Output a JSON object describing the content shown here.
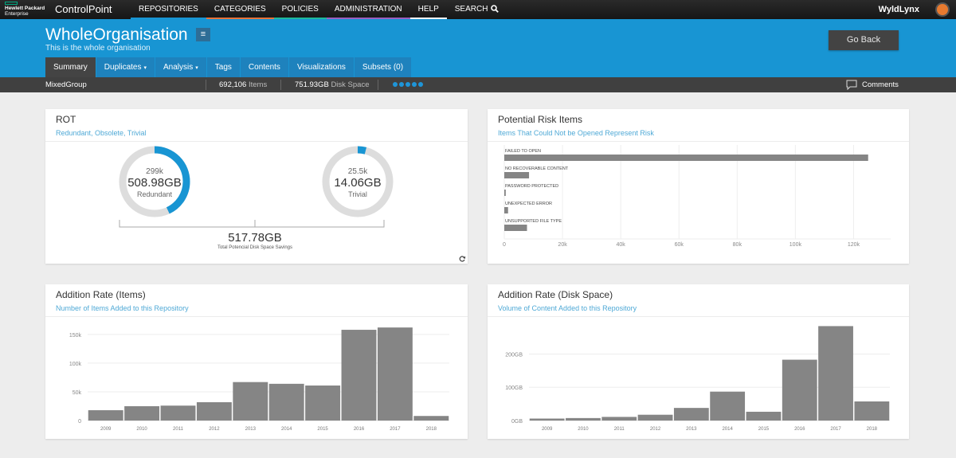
{
  "topnav": {
    "logo_line1": "Hewlett Packard",
    "logo_line2": "Enterprise",
    "brand": "ControlPoint",
    "items": [
      {
        "label": "REPOSITORIES",
        "color": "#1895d3"
      },
      {
        "label": "CATEGORIES",
        "color": "#e8733a"
      },
      {
        "label": "POLICIES",
        "color": "#1eb99a"
      },
      {
        "label": "ADMINISTRATION",
        "color": "#9b5fc0"
      },
      {
        "label": "HELP",
        "color": "#ffffff"
      }
    ],
    "search_label": "SEARCH",
    "search_icon": "search-icon",
    "username": "WyldLynx"
  },
  "header": {
    "title": "WholeOrganisation",
    "subtitle": "This is the whole organisation",
    "menu_icon": "≡",
    "go_back": "Go Back",
    "tabs": [
      {
        "label": "Summary",
        "active": true,
        "dropdown": false
      },
      {
        "label": "Duplicates",
        "active": false,
        "dropdown": true
      },
      {
        "label": "Analysis",
        "active": false,
        "dropdown": true
      },
      {
        "label": "Tags",
        "active": false,
        "dropdown": false
      },
      {
        "label": "Contents",
        "active": false,
        "dropdown": false
      },
      {
        "label": "Visualizations",
        "active": false,
        "dropdown": false
      },
      {
        "label": "Subsets (0)",
        "active": false,
        "dropdown": false
      }
    ],
    "caret": "▾"
  },
  "stats": {
    "group": "MixedGroup",
    "items_value": "692,106",
    "items_label": "Items",
    "disk_value": "751.93GB",
    "disk_label": "Disk Space",
    "comments": "Comments"
  },
  "rot": {
    "title": "ROT",
    "subtitle": "Redundant, Obsolete, Trivial",
    "redundant": {
      "count": "299k",
      "size": "508.98GB",
      "label": "Redundant",
      "fraction": 0.43
    },
    "trivial": {
      "count": "25.5k",
      "size": "14.06GB",
      "label": "Trivial",
      "fraction": 0.04
    },
    "total": "517.78GB",
    "total_label": "Total Potencial Disk Space Savings"
  },
  "colors": {
    "accent": "#1895d3",
    "bar": "#858585",
    "ring": "#dddddd"
  },
  "chart_data": [
    {
      "id": "risk",
      "type": "bar",
      "orientation": "horizontal",
      "title": "Potential Risk Items",
      "subtitle": "Items That Could Not be Opened Represent Risk",
      "categories": [
        "FAILED TO OPEN",
        "NO RECOVERABLE CONTENT",
        "PASSWORD PROTECTED",
        "UNEXPECTED ERROR",
        "UNSUPPORTED FILE TYPE"
      ],
      "values": [
        125000,
        8500,
        500,
        1300,
        7800
      ],
      "xlim": [
        0,
        130000
      ],
      "xticks": [
        0,
        20000,
        40000,
        60000,
        80000,
        100000,
        120000
      ],
      "xtick_labels": [
        "0",
        "20k",
        "40k",
        "60k",
        "80k",
        "100k",
        "120k"
      ],
      "grid": true
    },
    {
      "id": "items",
      "type": "bar",
      "title": "Addition Rate (Items)",
      "subtitle": "Number of Items Added to this Repository",
      "categories": [
        "2009",
        "2010",
        "2011",
        "2012",
        "2013",
        "2014",
        "2015",
        "2016",
        "2017",
        "2018"
      ],
      "values": [
        18000,
        25000,
        26000,
        32000,
        67000,
        64000,
        61000,
        158000,
        162000,
        8000
      ],
      "ylim": [
        0,
        165000
      ],
      "yticks": [
        0,
        50000,
        100000,
        150000
      ],
      "ytick_labels": [
        "0",
        "50k",
        "100k",
        "150k"
      ],
      "grid": true
    },
    {
      "id": "disk",
      "type": "bar",
      "title": "Addition Rate (Disk Space)",
      "subtitle": "Volume of Content Added to this Repository",
      "categories": [
        "2009",
        "2010",
        "2011",
        "2012",
        "2013",
        "2014",
        "2015",
        "2016",
        "2017",
        "2018"
      ],
      "values": [
        6000,
        7500,
        11000,
        17500,
        38000,
        87000,
        26500,
        183000,
        284000,
        57500
      ],
      "unit": "MB",
      "ylim": [
        0,
        285000
      ],
      "yticks": [
        0,
        100000,
        200000
      ],
      "ytick_labels": [
        "0GB",
        "100GB",
        "200GB"
      ],
      "grid": true
    }
  ]
}
